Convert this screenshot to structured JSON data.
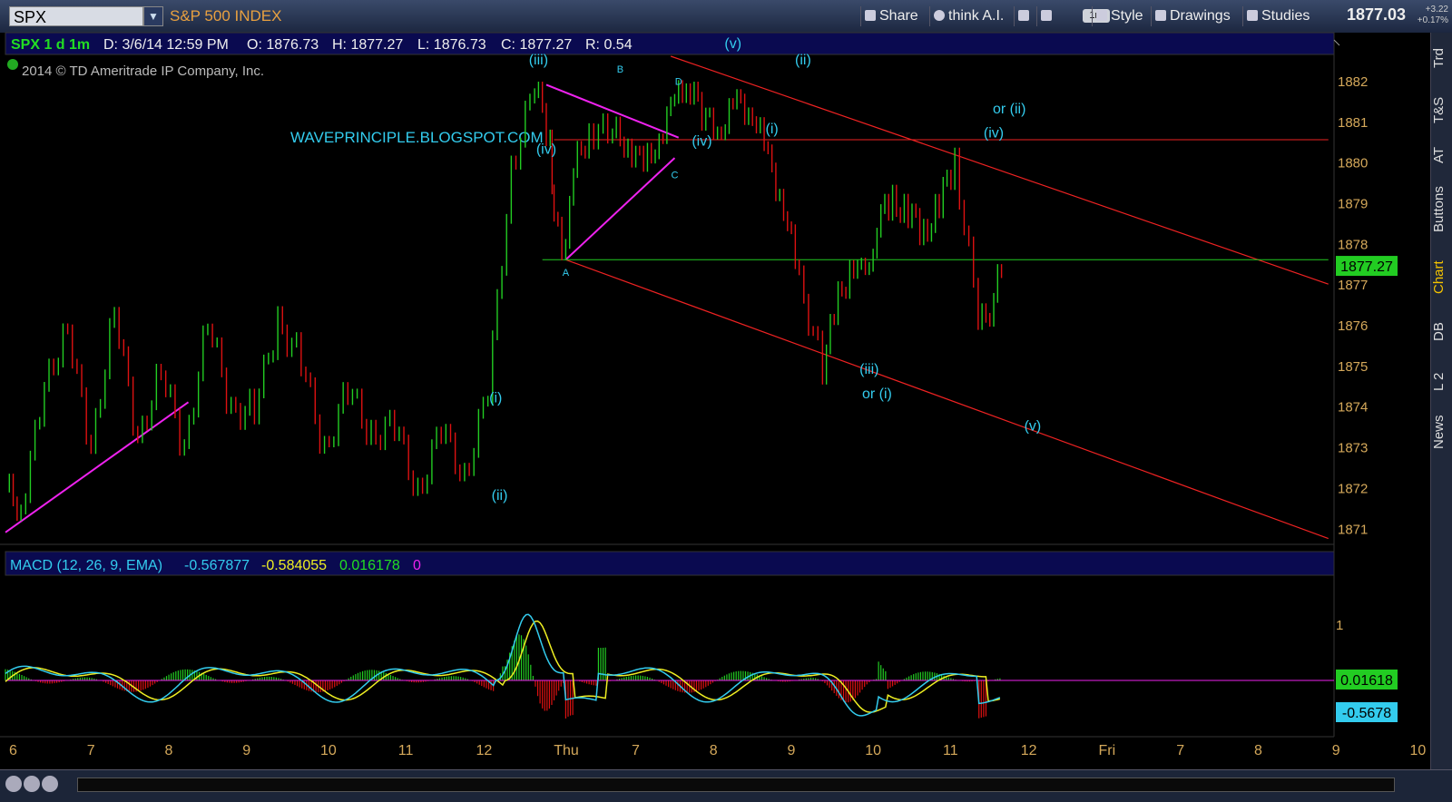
{
  "toolbar": {
    "symbol": "SPX",
    "symbol_name": "S&P 500 INDEX",
    "buttons": [
      "Share",
      "think A.I.",
      "Style",
      "Drawings",
      "Studies"
    ],
    "aggregation": "1m",
    "last": "1877.03",
    "change": "+3.22",
    "change_pct": "+0.17%"
  },
  "sidebar": {
    "tabs": [
      "Trd",
      "T&S",
      "AT",
      "Buttons",
      "Chart",
      "DB",
      "L 2",
      "News"
    ],
    "active": "Chart"
  },
  "info_bar": {
    "spec": "SPX 1 d 1m",
    "date": "D: 3/6/14 12:59 PM",
    "open": "O: 1876.73",
    "high": "H: 1877.27",
    "low": "L: 1876.73",
    "close": "C: 1877.27",
    "range": "R: 0.54"
  },
  "copyright": "2014 © TD Ameritrade IP Company, Inc.",
  "watermark": "WAVEPRINCIPLE.BLOGSPOT.COM",
  "colors": {
    "up": "#22cc22",
    "down": "#dd1111",
    "wave_label": "#33ccee",
    "trendline": "#ee22ee",
    "channel": "#ee2222",
    "level": "#22cc22",
    "macd_line": "#33ccee",
    "signal_line": "#eeee22",
    "axis_text": "#d4a85a"
  },
  "chart_data": {
    "type": "line",
    "title": "S&P 500 INDEX (SPX) 1-minute",
    "y_ticks": [
      1871,
      1872,
      1873,
      1874,
      1875,
      1876,
      1877,
      1878,
      1879,
      1880,
      1881,
      1882
    ],
    "ylim": [
      1870.65,
      1882.6
    ],
    "x_ticks": [
      "6",
      "7",
      "8",
      "9",
      "10",
      "11",
      "12",
      "Thu",
      "7",
      "8",
      "9",
      "10",
      "11",
      "12",
      "Fri",
      "7",
      "8",
      "9",
      "10"
    ],
    "current_price_label": "1877.27",
    "series": [
      {
        "name": "SPX",
        "x": [
          0,
          0.2,
          0.5,
          0.8,
          1.1,
          1.4,
          1.7,
          2.0,
          2.3,
          2.6,
          2.9,
          3.2,
          3.5,
          3.8,
          4.1,
          4.4,
          4.7,
          5.0,
          5.3,
          5.6,
          5.9,
          6.2,
          6.5,
          6.8,
          7.0,
          7.05,
          7.15,
          7.3,
          7.5,
          7.8,
          8.0,
          8.2,
          8.4,
          8.6,
          8.75,
          9.0,
          9.2,
          9.4,
          9.6,
          9.8,
          10.0,
          10.2,
          10.5,
          10.7,
          10.9,
          11.05,
          11.2,
          11.4,
          11.6,
          11.8,
          12.0,
          12.2,
          12.5,
          12.6,
          12.7,
          12.8
        ],
        "values": [
          1872.0,
          1871.5,
          1874.4,
          1876.0,
          1872.8,
          1876.5,
          1873.0,
          1875.0,
          1872.8,
          1876.2,
          1873.8,
          1874.0,
          1876.0,
          1875.2,
          1872.8,
          1874.5,
          1873.2,
          1873.6,
          1871.8,
          1873.5,
          1872.2,
          1874.4,
          1879.8,
          1881.9,
          1880.5,
          1878.8,
          1877.6,
          1879.8,
          1880.8,
          1880.7,
          1880.5,
          1879.8,
          1880.7,
          1881.4,
          1882.0,
          1881.0,
          1880.9,
          1881.4,
          1881.3,
          1880.0,
          1879.0,
          1877.0,
          1875.0,
          1876.6,
          1877.6,
          1877.0,
          1878.6,
          1879.0,
          1878.8,
          1878.2,
          1879.0,
          1880.0,
          1876.2,
          1876.0,
          1876.8,
          1877.27
        ]
      }
    ],
    "wave_labels": [
      {
        "text": "(i)",
        "x": 6.3,
        "y": 1874.1
      },
      {
        "text": "(ii)",
        "x": 6.35,
        "y": 1871.7
      },
      {
        "text": "(iii)",
        "x": 6.85,
        "y": 1882.4
      },
      {
        "text": "(iv)",
        "x": 6.95,
        "y": 1880.2
      },
      {
        "text": "A",
        "x": 7.2,
        "y": 1877.2
      },
      {
        "text": "B",
        "x": 7.9,
        "y": 1882.2
      },
      {
        "text": "C",
        "x": 8.6,
        "y": 1879.6
      },
      {
        "text": "D",
        "x": 8.65,
        "y": 1881.9
      },
      {
        "text": "(iv)",
        "x": 8.95,
        "y": 1880.4
      },
      {
        "text": "(v)",
        "x": 9.35,
        "y": 1882.8
      },
      {
        "text": "(i)",
        "x": 9.85,
        "y": 1880.7
      },
      {
        "text": "(ii)",
        "x": 10.25,
        "y": 1882.4
      },
      {
        "text": "(iii)",
        "x": 11.1,
        "y": 1874.8
      },
      {
        "text": "or (i)",
        "x": 11.2,
        "y": 1874.2
      },
      {
        "text": "(iv)",
        "x": 12.7,
        "y": 1880.6
      },
      {
        "text": "or (ii)",
        "x": 12.9,
        "y": 1881.2
      },
      {
        "text": "(v)",
        "x": 13.2,
        "y": 1873.4
      }
    ]
  },
  "macd": {
    "title": "MACD (12, 26, 9, EMA)",
    "value": "-0.567877",
    "avg": "-0.584055",
    "diff": "0.016178",
    "zero": "0",
    "y_tick": "1",
    "diff_label": "0.01618",
    "value_label": "-0.5678"
  }
}
